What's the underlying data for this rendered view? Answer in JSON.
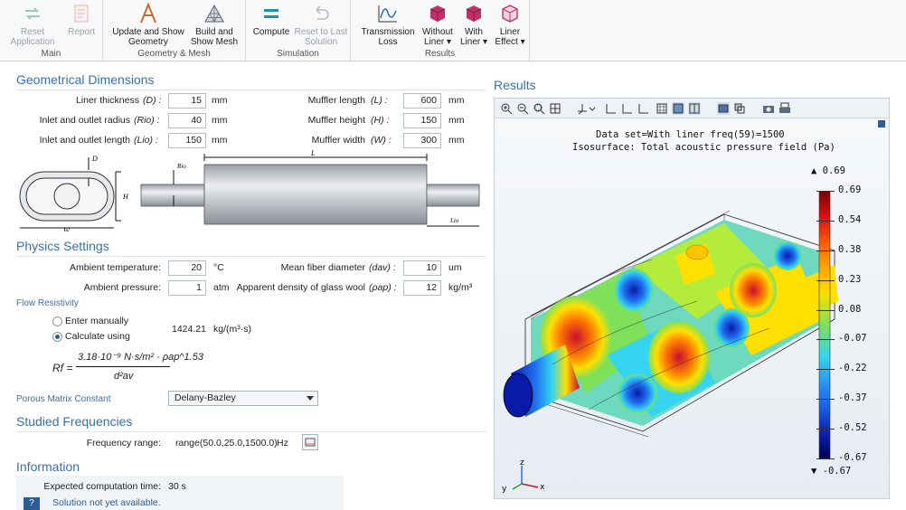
{
  "ribbon": {
    "groups": {
      "main": "Main",
      "geometry_mesh": "Geometry & Mesh",
      "simulation": "Simulation",
      "results": "Results"
    },
    "buttons": {
      "reset_application": "Reset\nApplication",
      "report": "Report",
      "update_geometry": "Update and Show\nGeometry",
      "build_mesh": "Build and\nShow Mesh",
      "compute": "Compute",
      "reset_last_solution": "Reset to Last\nSolution",
      "transmission_loss": "Transmission\nLoss",
      "without_liner": "Without\nLiner ▾",
      "with_liner": "With\nLiner ▾",
      "liner_effect": "Liner\nEffect ▾"
    }
  },
  "geometry": {
    "title": "Geometrical Dimensions",
    "liner_thickness": {
      "label": "Liner thickness",
      "symbol": "(D) :",
      "value": "15",
      "unit": "mm"
    },
    "inlet_radius": {
      "label": "Inlet and outlet radius",
      "symbol": "(Rio) :",
      "value": "40",
      "unit": "mm"
    },
    "inlet_length": {
      "label": "Inlet and outlet length",
      "symbol": "(Lio) :",
      "value": "150",
      "unit": "mm"
    },
    "muffler_length": {
      "label": "Muffler length",
      "symbol": "(L) :",
      "value": "600",
      "unit": "mm"
    },
    "muffler_height": {
      "label": "Muffler height",
      "symbol": "(H) :",
      "value": "150",
      "unit": "mm"
    },
    "muffler_width": {
      "label": "Muffler width",
      "symbol": "(W) :",
      "value": "300",
      "unit": "mm"
    },
    "sketch": {
      "D": "D",
      "H": "H",
      "W": "W",
      "L": "L",
      "Rio": "Rio",
      "Lio": "Lio"
    }
  },
  "physics": {
    "title": "Physics Settings",
    "ambient_temperature": {
      "label": "Ambient temperature:",
      "value": "20",
      "unit": "°C"
    },
    "ambient_pressure": {
      "label": "Ambient pressure:",
      "value": "1",
      "unit": "atm"
    },
    "fiber_diameter": {
      "label": "Mean fiber diameter",
      "symbol": "(dav) :",
      "value": "10",
      "unit": "um"
    },
    "glass_wool_density": {
      "label": "Apparent density of glass wool",
      "symbol": "(ρap) :",
      "value": "12",
      "unit": "kg/m³"
    },
    "flow_resistivity": {
      "title": "Flow Resistivity",
      "enter_manually": "Enter manually",
      "calculate_using": "Calculate using",
      "value": "1424.21",
      "unit": "kg/(m³·s)",
      "formula_lhs": "Rf =",
      "formula_num": "3.18·10⁻⁹ N·s/m² · ρap^1.53",
      "formula_den": "d²av"
    },
    "porous_matrix": {
      "label": "Porous Matrix Constant",
      "value": "Delany-Bazley"
    }
  },
  "frequencies": {
    "title": "Studied Frequencies",
    "label": "Frequency range:",
    "value": "range(50.0,25.0,1500.0)",
    "unit": "Hz"
  },
  "information": {
    "title": "Information",
    "time_label": "Expected computation time:",
    "time_value": "30 s",
    "status": "Solution not yet available."
  },
  "results": {
    "title": "Results",
    "plot_line1": "Data set=With liner freq(59)=1500",
    "plot_line2": "Isosurface: Total acoustic pressure field (Pa)",
    "axes": {
      "y": "y",
      "z": "z",
      "x": "x"
    }
  },
  "colorbar": {
    "max_label": "▲ 0.69",
    "min_label": "▼ -0.67",
    "ticks": [
      "0.69",
      "0.54",
      "0.38",
      "0.23",
      "0.08",
      "-0.07",
      "-0.22",
      "-0.37",
      "-0.52",
      "-0.67"
    ]
  },
  "colors": {
    "accent": "#3a6fa8",
    "hot": "#c8102e",
    "cold": "#0a1aa8"
  }
}
